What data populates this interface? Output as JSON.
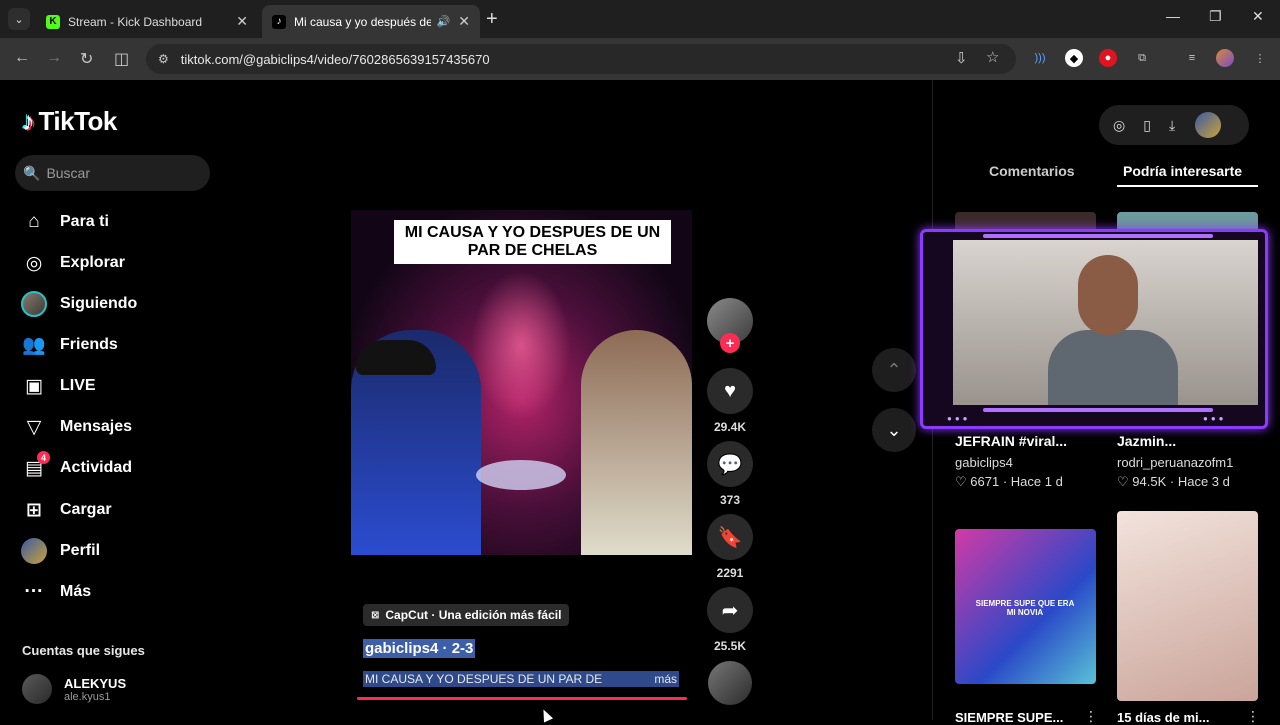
{
  "browser": {
    "tabs": [
      {
        "title": "Stream - Kick Dashboard",
        "favicon": "K",
        "active": false
      },
      {
        "title": "Mi causa y yo después de un par de chelas",
        "favicon": "tiktok",
        "active": true
      }
    ],
    "url": "tiktok.com/@gabiclips4/video/7602865639157435670"
  },
  "brand": {
    "name": "TikTok",
    "accent": "#fe2c55"
  },
  "search": {
    "placeholder": "Buscar"
  },
  "nav": [
    {
      "label": "Para ti",
      "icon": "home-icon"
    },
    {
      "label": "Explorar",
      "icon": "compass-icon"
    },
    {
      "label": "Siguiendo",
      "icon": "following-avatar"
    },
    {
      "label": "Friends",
      "icon": "friends-icon"
    },
    {
      "label": "LIVE",
      "icon": "live-icon"
    },
    {
      "label": "Mensajes",
      "icon": "messages-icon"
    },
    {
      "label": "Actividad",
      "icon": "activity-icon",
      "badge": "4"
    },
    {
      "label": "Cargar",
      "icon": "upload-icon"
    },
    {
      "label": "Perfil",
      "icon": "profile-avatar"
    },
    {
      "label": "Más",
      "icon": "more-icon"
    }
  ],
  "following": {
    "title": "Cuentas que sigues",
    "accounts": [
      {
        "name": "ALEKYUS",
        "handle": "ale.kyus1"
      }
    ]
  },
  "video": {
    "overlay_text": "MI CAUSA Y YO DESPUES DE UN PAR DE CHELAS",
    "capcut": "CapCut · Una edición más fácil",
    "author_line": "gabiclips4 · 2-3",
    "description": "MI CAUSA Y YO DESPUES DE UN PAR DE",
    "more": "más",
    "likes": "29.4K",
    "comments": "373",
    "saves": "2291",
    "shares": "25.5K"
  },
  "right_panel": {
    "tabs": [
      "Comentarios",
      "Podría interesarte"
    ],
    "active_tab": "Podría interesarte",
    "cards": [
      {
        "title": "JEFRAIN #viral...",
        "user": "gabiclips4",
        "likes": "6671",
        "time": "Hace 1 d"
      },
      {
        "title": "Jazmin...",
        "user": "rodri_peruanazofm1",
        "likes": "94.5K",
        "time": "Hace 3 d"
      },
      {
        "title": "SIEMPRE SUPE...",
        "overlay": "SIEMPRE SUPE QUE ERA MI NOVIA"
      },
      {
        "title": "15 días de mi..."
      }
    ]
  }
}
